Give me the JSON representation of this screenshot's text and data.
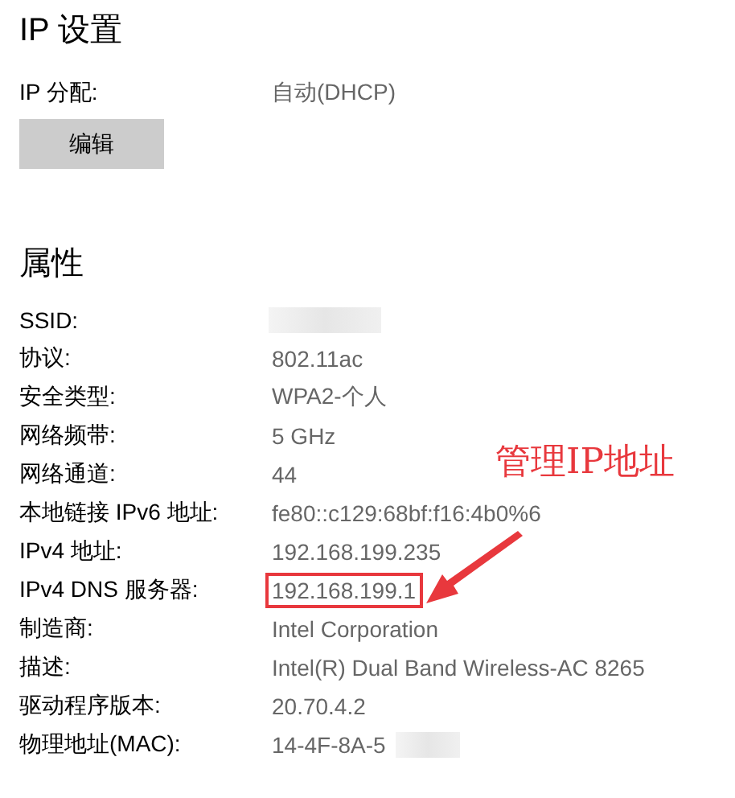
{
  "ip_settings": {
    "title": "IP 设置",
    "label": "IP 分配:",
    "value": "自动(DHCP)",
    "button": "编辑"
  },
  "properties": {
    "title": "属性",
    "rows": [
      {
        "label": "SSID:",
        "kind": "redacted"
      },
      {
        "label": "协议:",
        "value": "802.11ac",
        "highlighted": false
      },
      {
        "label": "安全类型:",
        "value": "WPA2-个人",
        "highlighted": false
      },
      {
        "label": "网络频带:",
        "value": "5 GHz",
        "highlighted": false
      },
      {
        "label": "网络通道:",
        "value": "44",
        "highlighted": false
      },
      {
        "label": "本地链接 IPv6 地址:",
        "value": "fe80::c129:68bf:f16:4b0%6",
        "highlighted": false
      },
      {
        "label": "IPv4 地址:",
        "value": "192.168.199.235",
        "highlighted": false
      },
      {
        "label": "IPv4 DNS 服务器:",
        "value": "192.168.199.1",
        "highlighted": true
      },
      {
        "label": "制造商:",
        "value": "Intel Corporation",
        "highlighted": false
      },
      {
        "label": "描述:",
        "value": "Intel(R) Dual Band Wireless-AC 8265",
        "highlighted": false
      },
      {
        "label": "驱动程序版本:",
        "value": "20.70.4.2",
        "highlighted": false
      },
      {
        "label": "物理地址(MAC):",
        "value": "14-4F-8A-5",
        "kind": "partly-redacted",
        "highlighted": false
      }
    ]
  },
  "annotation": {
    "text": "管理IP地址"
  }
}
